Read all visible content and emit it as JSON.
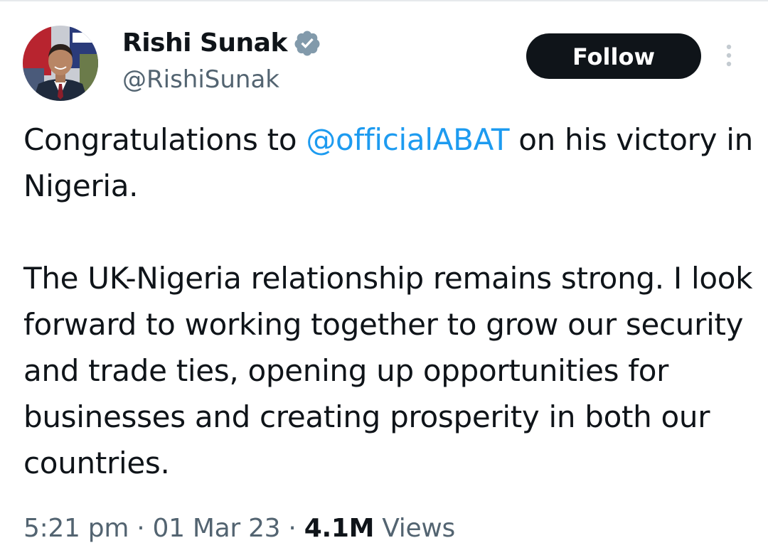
{
  "author": {
    "name": "Rishi Sunak",
    "handle": "@RishiSunak",
    "verified_icon": "verified-badge-icon",
    "verified_color": "#829aab"
  },
  "actions": {
    "follow_label": "Follow",
    "more_icon": "more-vertical-icon"
  },
  "tweet": {
    "p1_before": "Congratulations to ",
    "mention": "@officialABAT",
    "p1_after": " on his victory in Nigeria.",
    "p2": "The UK-Nigeria relationship remains strong. I look forward to working together to grow our security and trade ties, opening up opportunities for businesses and creating prosperity in both our countries.",
    "mention_color": "#1d9bf0"
  },
  "meta": {
    "time": "5:21 pm",
    "sep1": " · ",
    "date": "01 Mar 23",
    "sep2": " · ",
    "views_count": "4.1M",
    "views_label": " Views"
  }
}
